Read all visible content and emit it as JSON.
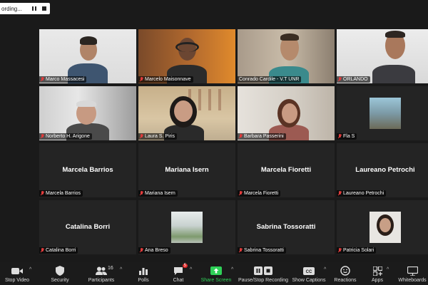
{
  "recording": {
    "label": "ording..."
  },
  "participants": [
    {
      "name": "Marco Massacesi"
    },
    {
      "name": "Marcelo Maisonnave"
    },
    {
      "name": "Conrado Cardile - V.T UNR"
    },
    {
      "name": "ORLANDO"
    },
    {
      "name": "Norberto H. Arigone"
    },
    {
      "name": "Laura S. Piris"
    },
    {
      "name": "Barbara Passerini"
    },
    {
      "name": "Fla S"
    },
    {
      "name": "Marcela Barrios",
      "display": "Marcela Barrios"
    },
    {
      "name": "Mariana Isern",
      "display": "Mariana Isern"
    },
    {
      "name": "Marcela Fioretti",
      "display": "Marcela Fioretti"
    },
    {
      "name": "Laureano Petrochi",
      "display": "Laureano Petrochi"
    },
    {
      "name": "Catalina Borri",
      "display": "Catalina Borri"
    },
    {
      "name": "Ana Breso"
    },
    {
      "name": "Sabrina Tossoratti",
      "display": "Sabrina Tossoratti"
    },
    {
      "name": "Patricia Solari"
    }
  ],
  "toolbar": {
    "stop_video": "Stop Video",
    "security": "Security",
    "participants": "Participants",
    "participants_count": "16",
    "polls": "Polls",
    "chat": "Chat",
    "chat_badge": "5",
    "share_screen": "Share Screen",
    "pause_stop_recording": "Pause/Stop Recording",
    "show_captions": "Show Captions",
    "reactions": "Reactions",
    "apps": "Apps",
    "whiteboards": "Whiteboards"
  },
  "colors": {
    "share_green": "#2fd158",
    "active_speaker": "#b8e036",
    "muted_red": "#e03c3c"
  }
}
